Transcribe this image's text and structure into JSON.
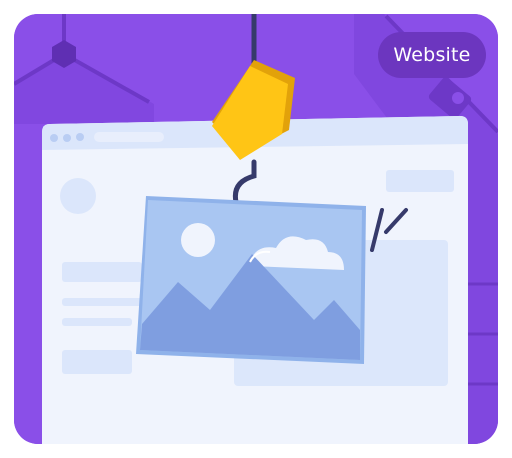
{
  "badge": {
    "label": "Website"
  },
  "colors": {
    "background": "#8a4fe8",
    "badge": "#6c36bf",
    "browser_frame": "#f0f4fd",
    "browser_bar": "#dbe6fb",
    "image_card": "#a9c6f2",
    "hook_block": "#ffc515",
    "hook_line": "#363a6b"
  },
  "icons": [
    "browser-window",
    "crane-hook",
    "image-placeholder",
    "motion-lines",
    "gear"
  ]
}
